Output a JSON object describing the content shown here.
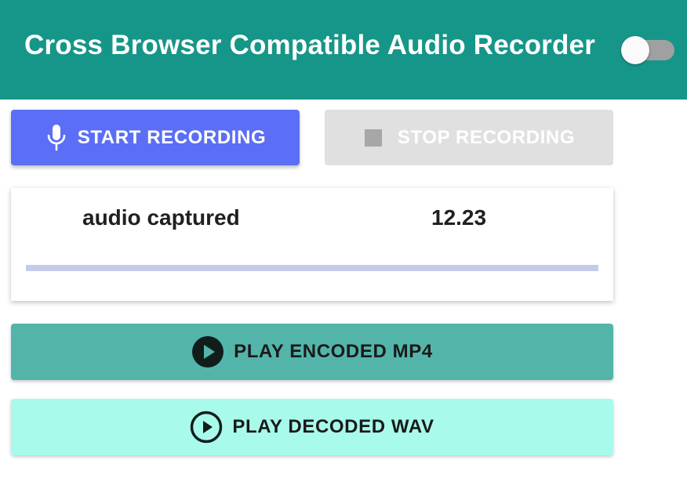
{
  "header": {
    "title": "Cross Browser Compatible Audio Recorder",
    "background": "#169688",
    "toggle": {
      "state": "off",
      "icon": "toggle-switch-icon"
    }
  },
  "controls": {
    "start_label": "START RECORDING",
    "start_icon": "microphone-icon",
    "stop_label": "STOP RECORDING",
    "stop_icon": "stop-square-icon",
    "stop_disabled": true
  },
  "capture": {
    "label": "audio captured",
    "value": "12.23",
    "progress_fraction": 0
  },
  "playback": {
    "mp4_label": "PLAY ENCODED MP4",
    "mp4_icon": "play-circle-filled-icon",
    "wav_label": "PLAY DECODED WAV",
    "wav_icon": "play-circle-outline-icon"
  },
  "colors": {
    "accent": "#5b6ef5",
    "teal": "#53b5aa",
    "mint": "#a8fbea",
    "disabled": "#e0e0e0"
  }
}
